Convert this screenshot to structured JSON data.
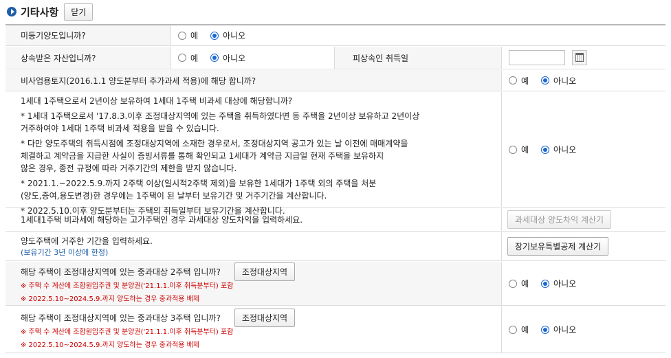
{
  "section": {
    "title": "기타사항",
    "close_label": "닫기"
  },
  "radio": {
    "yes": "예",
    "no": "아니오"
  },
  "rows": {
    "unregistered": {
      "label": "미등기양도입니까?"
    },
    "inherited": {
      "label": "상속받은 자산입니까?",
      "acquire_label": "피상속인 취득일",
      "date_value": ""
    },
    "nonbusiness": {
      "label": "비사업용토지(2016.1.1 양도분부터 추가과세 적용)에 해당 합니까?"
    },
    "one_house": {
      "title": "1세대 1주택으로서 2년이상 보유하여 1세대 1주택 비과세 대상에 해당합니까?",
      "p1a": "* 1세대 1주택으로서 '17.8.3.이후 조정대상지역에 있는 주택을 취득하였다면 동 주택을 2년이상 보유하고 2년이상",
      "p1b": "거주하여야 1세대 1주택 비과세 적용을 받을 수 있습니다.",
      "p2a": "* 다만 양도주택의 취득시점에 조정대상지역에 소재한 경우로서, 조정대상지역 공고가 있는 날 이전에 매매계약을",
      "p2b": "체결하고 계약금을 지급한 사실이 증빙서류를 통해 확인되고 1세대가 계약금 지급일 현재 주택을 보유하지",
      "p2c": "않은 경우, 종전 규정에 따라 거주기간의 제한을 받지 않습니다.",
      "p3a": "* 2021.1.~2022.5.9.까지 2주택 이상(일시적2주택 제외)을 보유한 1세대가 1주택 외의 주택을 처분",
      "p3b": "(양도,증여,용도변경)한 경우에는 1주택이 된 날부터 보유기간 및 거주기간을 계산합니다.",
      "p4": "* 2022.5.10.이후 양도분부터는 주택의 취득일부터 보유기간을 계산합니다."
    },
    "luxury": {
      "label": "1세대1주택 비과세에 해당하는 고가주택인 경우 과세대상 양도차익을 입력하세요.",
      "button": "과세대상 양도차익 계산기"
    },
    "residence": {
      "label": "양도주택에 거주한 기간을 입력하세요.",
      "note": "(보유기간 3년 이상에 한정)",
      "button": "장기보유특별공제 계산기"
    },
    "heavy2": {
      "label": "해당 주택이 조정대상지역에 있는 중과대상 2주택 입니까?",
      "button": "조정대상지역",
      "note1": "※ 주택 수 계산에 조합원입주권 및 분양권('21.1.1.이후 취득분부터) 포함",
      "note2": "※ 2022.5.10~2024.5.9.까지 양도하는 경우 중과적용 배제"
    },
    "heavy3": {
      "label": "해당 주택이 조정대상지역에 있는 중과대상 3주택 입니까?",
      "button": "조정대상지역",
      "note1": "※ 주택 수 계산에 조합원입주권 및 분양권('21.1.1.이후 취득분부터) 포함",
      "note2": "※ 2022.5.10~2024.5.9.까지 양도하는 경우 중과적용 배제"
    }
  },
  "colors": {
    "accent": "#1d5fa9",
    "radio": "#1b66d2",
    "warning": "#cc0000"
  }
}
